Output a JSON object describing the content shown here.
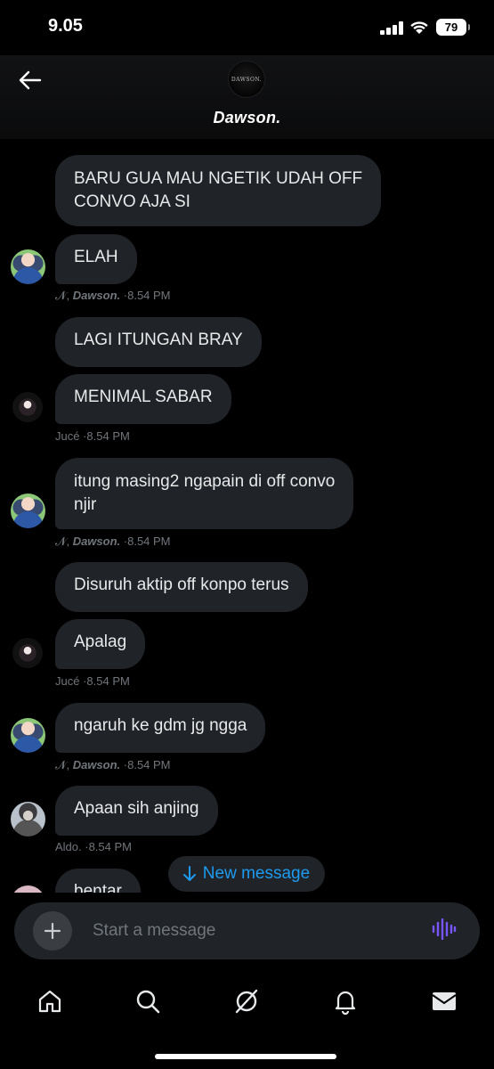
{
  "status_bar": {
    "time": "9.05",
    "battery": "79"
  },
  "header": {
    "group_name": "Dawson.",
    "avatar_text": "DAWSON."
  },
  "messages": [
    {
      "text_lines": [
        "BARU GUA MAU NGETIK UDAH OFF",
        "CONVO AJA SI"
      ]
    },
    {
      "text": "ELAH",
      "meta_prefix": "𝓝, ",
      "sender": "Dawson.",
      "time": " ·8.54 PM"
    },
    {
      "text": "LAGI ITUNGAN BRAY"
    },
    {
      "text": "MENIMAL SABAR",
      "sender": "Jucé",
      "time": " ·8.54 PM"
    },
    {
      "text_lines": [
        "itung masing2 ngapain di off convo",
        "njir"
      ],
      "meta_prefix": "𝓝, ",
      "sender": "Dawson.",
      "time": " ·8.54 PM"
    },
    {
      "text": "Disuruh aktip off konpo terus"
    },
    {
      "text": "Apalag",
      "sender": "Jucé",
      "time": " ·8.54 PM"
    },
    {
      "text": "ngaruh ke gdm jg ngga",
      "meta_prefix": "𝓝, ",
      "sender": "Dawson.",
      "time": " ·8.54 PM"
    },
    {
      "text": "Apaan sih anjing",
      "sender": "Aldo.",
      "time": " ·8.54 PM"
    },
    {
      "text": "bentar"
    }
  ],
  "new_message_label": "New message",
  "composer": {
    "placeholder": "Start a message"
  },
  "colors": {
    "accent": "#1d9bf0",
    "bubble": "#202327",
    "voice": "#7856ff"
  },
  "tabs": [
    "home-icon",
    "search-icon",
    "grok-icon",
    "notifications-icon",
    "messages-icon"
  ]
}
